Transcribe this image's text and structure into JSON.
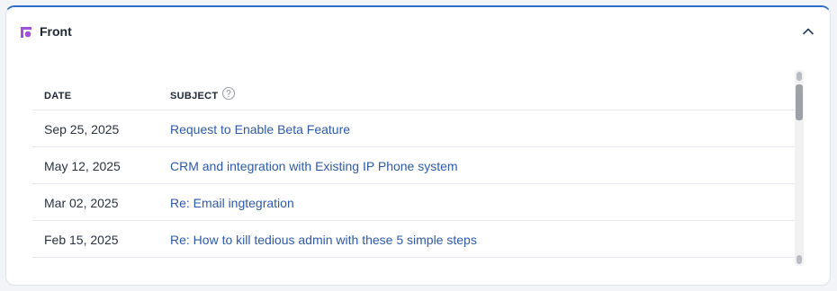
{
  "panel": {
    "title": "Front",
    "logo_icon": "front-logo-icon",
    "collapse_icon": "chevron-up-icon",
    "accent_color": "#2f6bc8",
    "logo_color": "#a24fe0"
  },
  "table": {
    "columns": {
      "date": "DATE",
      "subject": "SUBJECT",
      "subject_help_icon": "help-circle-icon"
    },
    "rows": [
      {
        "date": "Sep 25, 2025",
        "subject": "Request to Enable Beta Feature"
      },
      {
        "date": "May 12, 2025",
        "subject": "CRM and integration with Existing IP Phone system"
      },
      {
        "date": "Mar 02, 2025",
        "subject": "Re: Email ingtegration"
      },
      {
        "date": "Feb 15, 2025",
        "subject": "Re: How to kill tedious admin with these 5 simple steps"
      }
    ],
    "link_color": "#2d5aa8"
  }
}
